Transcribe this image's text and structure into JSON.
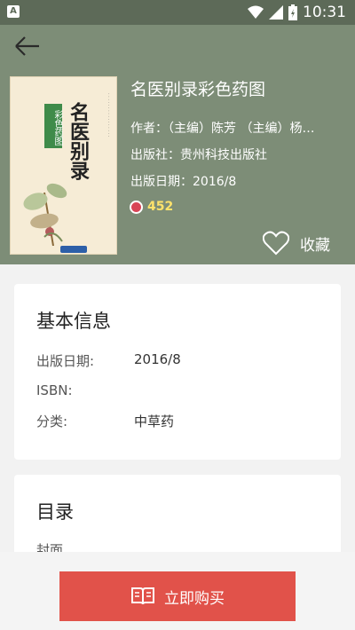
{
  "status_bar": {
    "time": "10:31",
    "battery_level": "6"
  },
  "book": {
    "title": "名医别录彩色药图",
    "author": "作者：（主编）陈芳 （主编）杨…",
    "publisher": "出版社：贵州科技出版社",
    "publish_date": "出版日期：2016/8",
    "read_count": "452",
    "cover": {
      "title": "名医别录",
      "tag": "彩色药图"
    }
  },
  "favorite": {
    "label": "收藏"
  },
  "basic_info": {
    "heading": "基本信息",
    "rows": [
      {
        "label": "出版日期:",
        "value": "2016/8"
      },
      {
        "label": "ISBN:",
        "value": ""
      },
      {
        "label": "分类:",
        "value": "中草药"
      }
    ]
  },
  "toc": {
    "heading": "目录",
    "items": [
      "封面"
    ]
  },
  "buy_button": {
    "label": "立即购买"
  },
  "colors": {
    "header": "#7d8d77",
    "accent": "#e1524a"
  }
}
